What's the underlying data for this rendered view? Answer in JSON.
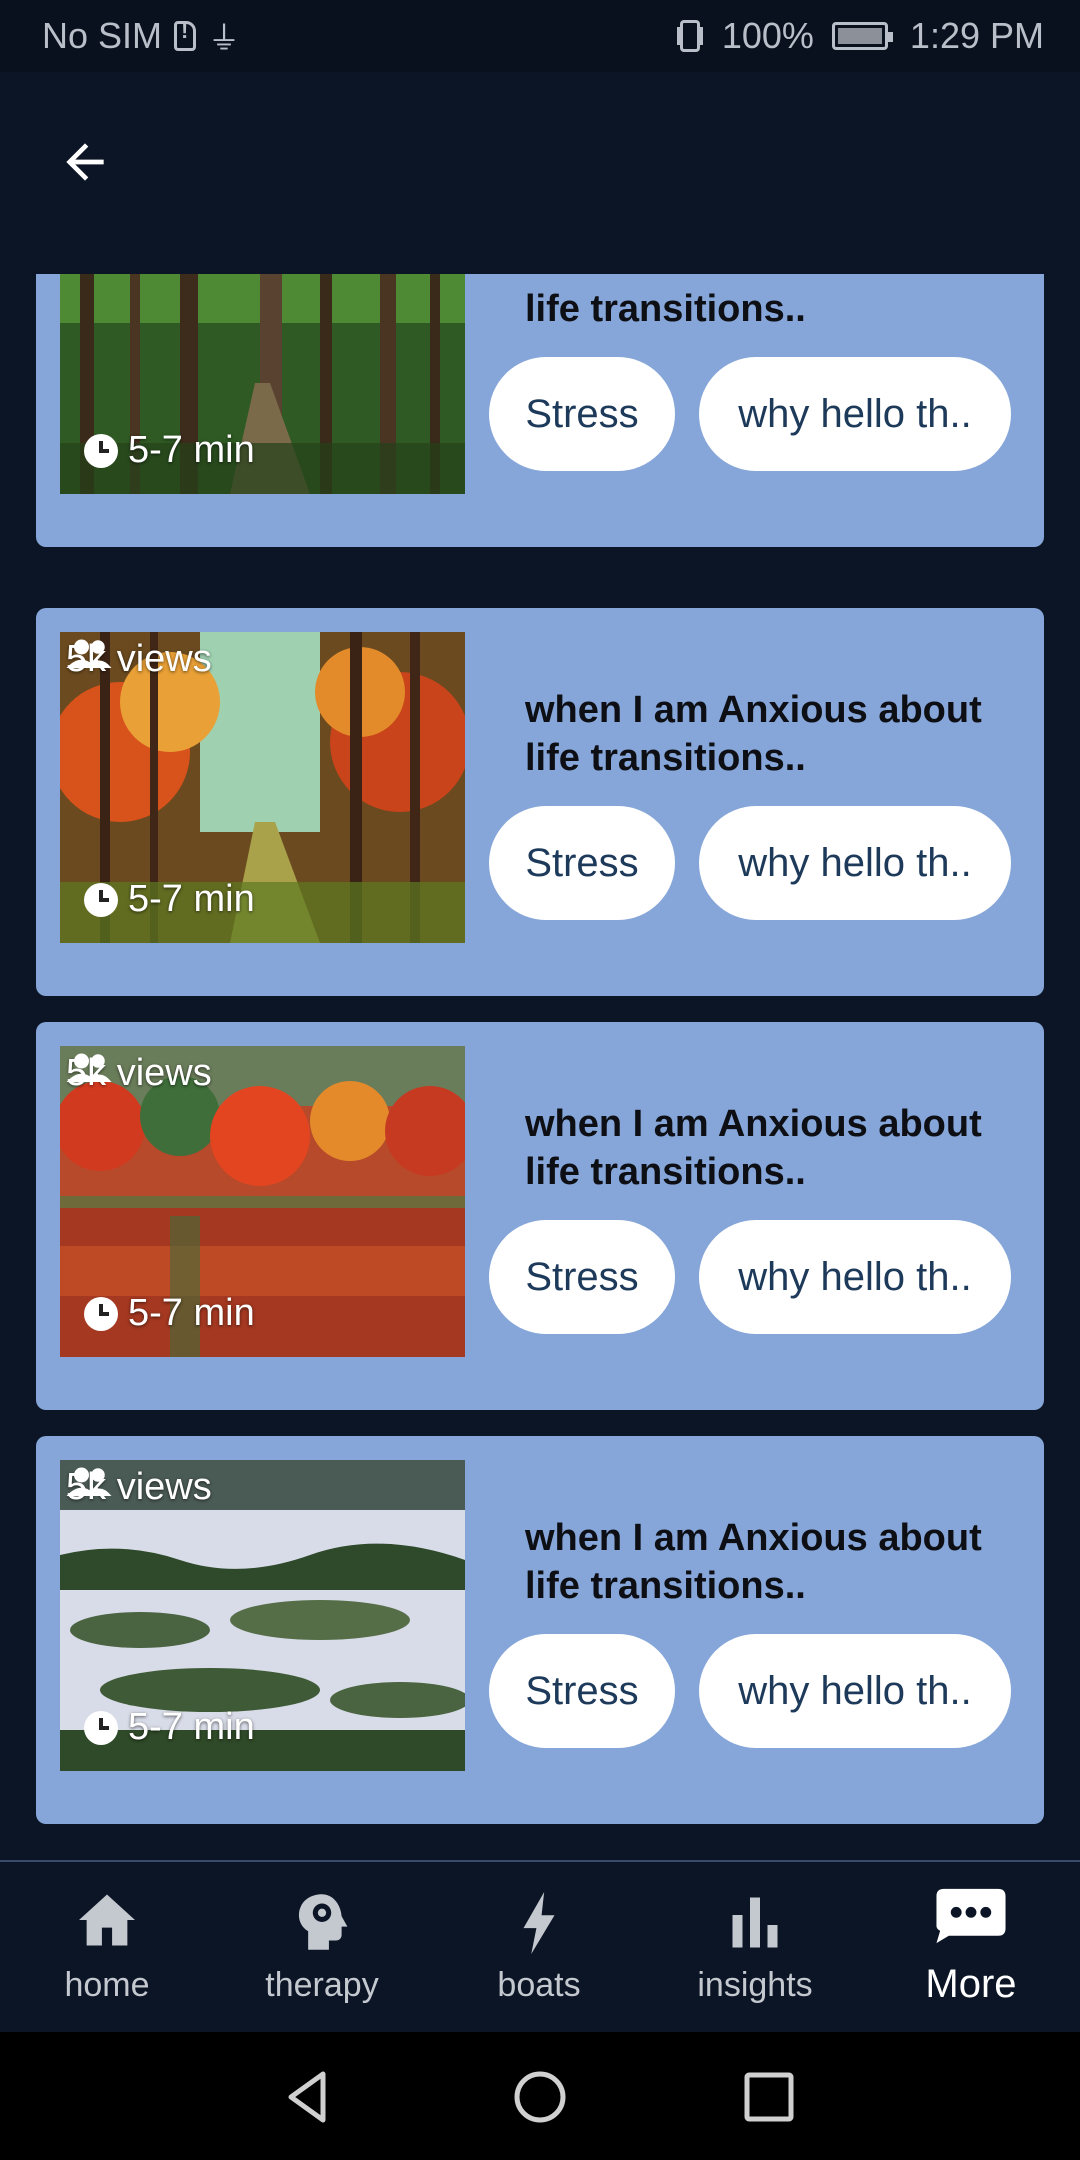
{
  "status_bar": {
    "carrier": "No SIM",
    "battery": "100%",
    "time": "1:29 PM"
  },
  "cards": [
    {
      "views": "",
      "duration": "5-7 min",
      "title": "when I am Anxious about life transitions..",
      "tags": [
        "Stress",
        "why hello th.."
      ]
    },
    {
      "views": "5k views",
      "duration": "5-7 min",
      "title": "when I am Anxious about life transitions..",
      "tags": [
        "Stress",
        "why hello th.."
      ]
    },
    {
      "views": "5k views",
      "duration": "5-7 min",
      "title": "when I am Anxious about life transitions..",
      "tags": [
        "Stress",
        "why hello th.."
      ]
    },
    {
      "views": "5k views",
      "duration": "5-7 min",
      "title": "when I am Anxious about life transitions..",
      "tags": [
        "Stress",
        "why hello th.."
      ]
    }
  ],
  "bottom_nav": {
    "items": [
      {
        "label": "home",
        "icon": "home-icon"
      },
      {
        "label": "therapy",
        "icon": "head-gear-icon"
      },
      {
        "label": "boats",
        "icon": "bolt-icon"
      },
      {
        "label": "insights",
        "icon": "bar-chart-icon"
      },
      {
        "label": "More",
        "icon": "chat-dots-icon",
        "active": true
      }
    ]
  }
}
